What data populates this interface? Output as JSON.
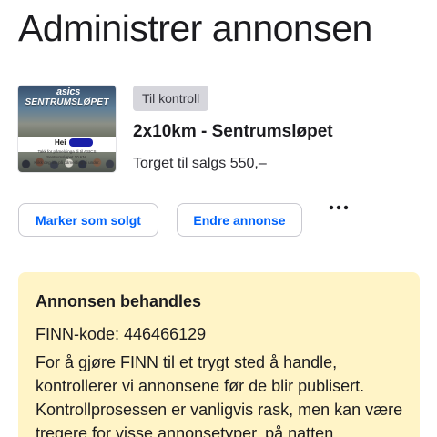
{
  "page": {
    "title": "Administrer annonsen"
  },
  "listing": {
    "status": "Til kontroll",
    "title": "2x10km - Sentrumsløpet",
    "price": "Torget til salgs 550,–",
    "image": {
      "logo": "asics",
      "event": "SENTRUMSLØPET",
      "greeting": "Hei",
      "lines": [
        "Takk for påmeldinga di til ASICS",
        "Sentrumsløpet 10 KM.",
        "Klikk deg inn på påmelding di under."
      ]
    }
  },
  "actions": {
    "mark_sold": "Marker som solgt",
    "edit": "Endre annonse",
    "more_icon": "more-horizontal-icon"
  },
  "notice": {
    "heading": "Annonsen behandles",
    "code": "FINN-kode: 446466129",
    "text": "For å gjøre FINN til et trygt sted å handle, kontrollerer vi annonsene før de blir publisert. Kontrollprosessen er vanligvis rask, men kan være tregere for visse annonsetyper, på natten"
  },
  "colors": {
    "accent": "#0063fb",
    "notice_bg": "#fff4c7",
    "badge_bg": "#d6d6dc"
  }
}
